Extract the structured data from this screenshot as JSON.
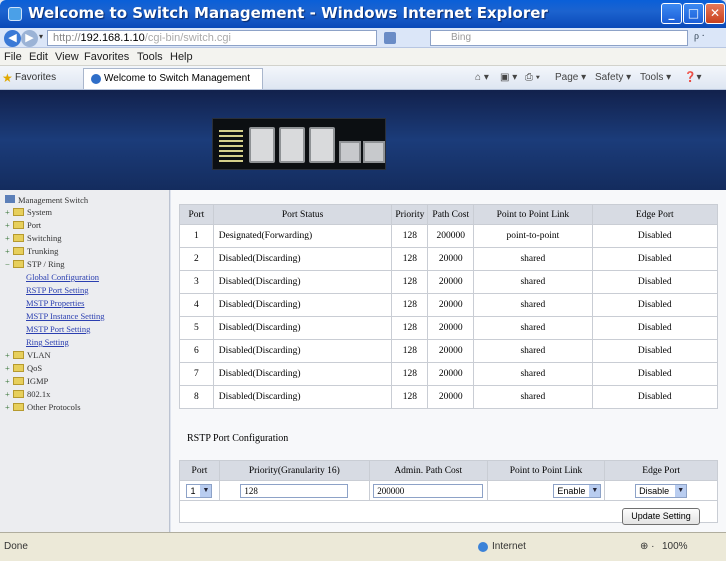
{
  "window": {
    "title": "Welcome to Switch Management - Windows Internet Explorer",
    "minimize": "_",
    "maximize": "□",
    "close": "✕"
  },
  "address": {
    "protocol": "http://",
    "host": "192.168.1.10",
    "rest": "/cgi-bin/switch.cgi",
    "search_placeholder": "Bing",
    "search_go": "ρ ·"
  },
  "menu": [
    "File",
    "Edit",
    "View",
    "Favorites",
    "Tools",
    "Help"
  ],
  "favorites": {
    "label": "Favorites",
    "tab_title": "Welcome to Switch Management",
    "commands": [
      "Page ▾",
      "Safety ▾",
      "Tools ▾"
    ]
  },
  "sidebar": {
    "root": "Management Switch",
    "items": [
      "System",
      "Port",
      "Switching",
      "Trunking",
      "STP / Ring",
      "VLAN",
      "QoS",
      "IGMP",
      "802.1x",
      "Other Protocols"
    ],
    "stp_sub": [
      "Global Configuration",
      "RSTP Port Setting",
      "MSTP Properties",
      "MSTP Instance Setting",
      "MSTP Port Setting",
      "Ring Setting"
    ]
  },
  "port_table": {
    "headers": [
      "Port",
      "Port Status",
      "Priority",
      "Path Cost",
      "Point to Point Link",
      "Edge Port"
    ],
    "rows": [
      [
        "1",
        "Designated(Forwarding)",
        "128",
        "200000",
        "point-to-point",
        "Disabled"
      ],
      [
        "2",
        "Disabled(Discarding)",
        "128",
        "20000",
        "shared",
        "Disabled"
      ],
      [
        "3",
        "Disabled(Discarding)",
        "128",
        "20000",
        "shared",
        "Disabled"
      ],
      [
        "4",
        "Disabled(Discarding)",
        "128",
        "20000",
        "shared",
        "Disabled"
      ],
      [
        "5",
        "Disabled(Discarding)",
        "128",
        "20000",
        "shared",
        "Disabled"
      ],
      [
        "6",
        "Disabled(Discarding)",
        "128",
        "20000",
        "shared",
        "Disabled"
      ],
      [
        "7",
        "Disabled(Discarding)",
        "128",
        "20000",
        "shared",
        "Disabled"
      ],
      [
        "8",
        "Disabled(Discarding)",
        "128",
        "20000",
        "shared",
        "Disabled"
      ]
    ]
  },
  "config": {
    "title": "RSTP Port Configuration",
    "headers": [
      "Port",
      "Priority(Granularity 16)",
      "Admin. Path Cost",
      "Point to Point Link",
      "Edge Port"
    ],
    "port_value": "1",
    "priority_value": "128",
    "path_cost_value": "200000",
    "p2p_value": "Enable",
    "edge_value": "Disable",
    "button": "Update Setting"
  },
  "status": {
    "left": "Done",
    "zone": "Internet",
    "zoom": "100%",
    "zoom_prefix": "⊕ ·"
  }
}
